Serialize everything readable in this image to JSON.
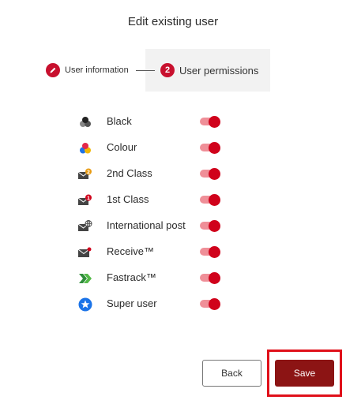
{
  "page": {
    "title": "Edit existing user"
  },
  "stepper": {
    "step1": {
      "label": "User information",
      "icon": "pencil-icon"
    },
    "step2": {
      "number": "2",
      "label": "User permissions"
    }
  },
  "permissions": [
    {
      "label": "Black",
      "icon": "black-ink-icon",
      "enabled": true
    },
    {
      "label": "Colour",
      "icon": "colour-ink-icon",
      "enabled": true
    },
    {
      "label": "2nd Class",
      "icon": "second-class-mail-icon",
      "badge": "2",
      "enabled": true
    },
    {
      "label": "1st Class",
      "icon": "first-class-mail-icon",
      "badge": "1",
      "enabled": true
    },
    {
      "label": "International post",
      "icon": "international-mail-icon",
      "enabled": true
    },
    {
      "label": "Receive™",
      "icon": "receive-mail-icon",
      "enabled": true
    },
    {
      "label": "Fastrack™",
      "icon": "fastrack-icon",
      "enabled": true
    },
    {
      "label": "Super user",
      "icon": "star-icon",
      "enabled": true
    }
  ],
  "actions": {
    "back_label": "Back",
    "save_label": "Save"
  },
  "colors": {
    "accent": "#c8102e",
    "save_bg": "#8c1414",
    "toggle_track": "#ef8f98",
    "highlight": "#e0101a"
  }
}
